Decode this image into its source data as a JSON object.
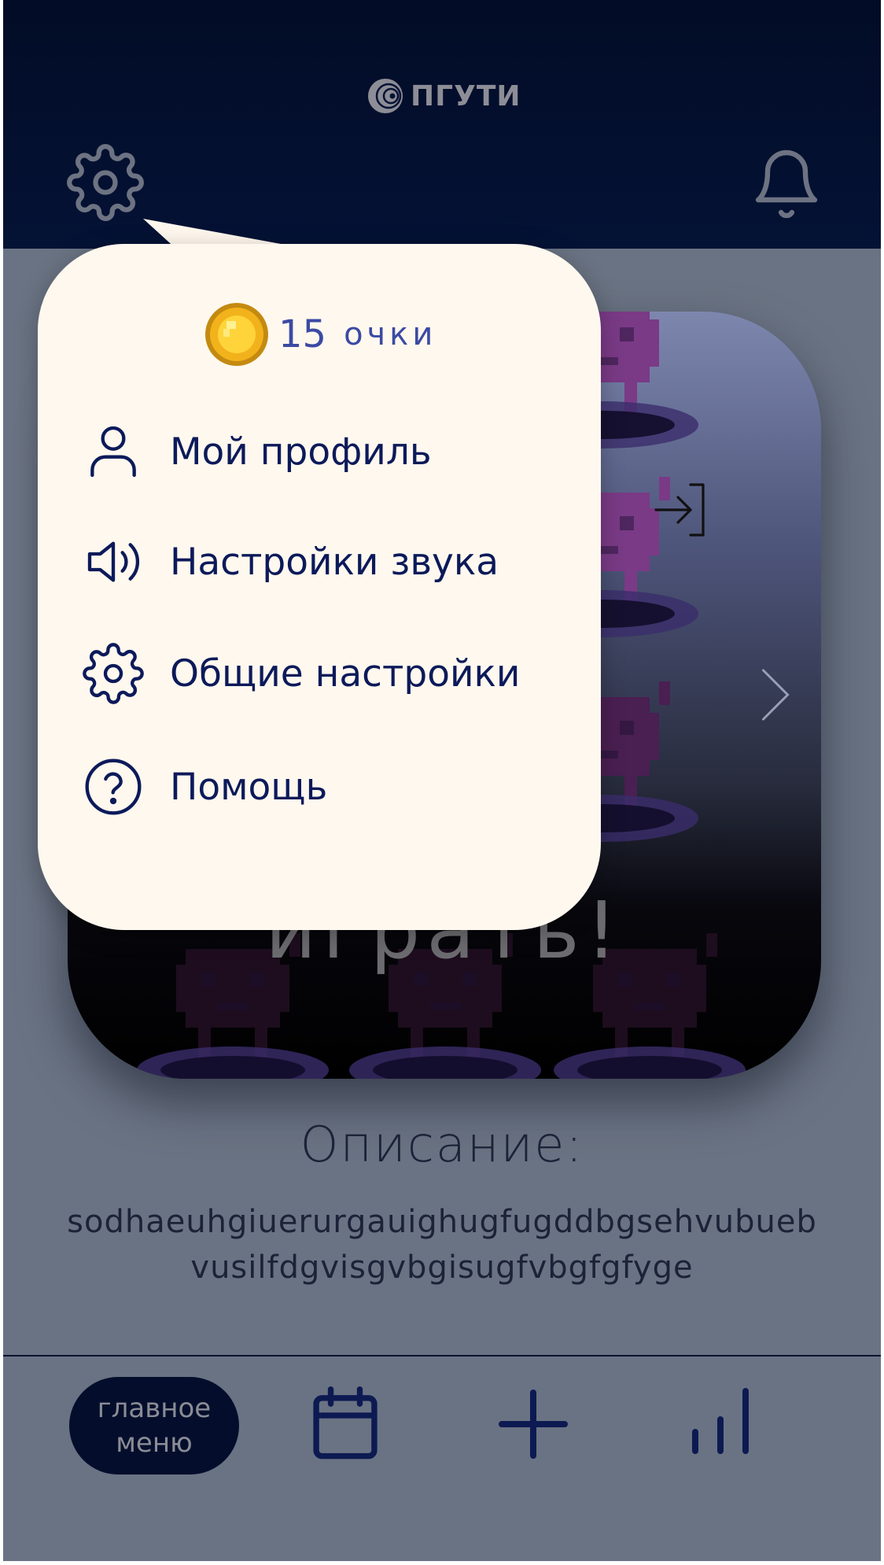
{
  "header": {
    "brand": "ПГУТИ",
    "icons": {
      "settings": "gear-icon",
      "notifications": "bell-icon"
    }
  },
  "game_card": {
    "play_label": "играть!",
    "icons": {
      "next": "chevron-right-icon",
      "enter": "log-in-icon"
    }
  },
  "description": {
    "title": "Описание:",
    "text": "sodhaeuhgiuerurgauighugfugddbgsehvubuebvusilfdgvisgvbgisugfvbgfgfyge"
  },
  "bottom_nav": {
    "home_label": "главное меню",
    "icons": [
      "calendar-icon",
      "plus-icon",
      "bar-chart-icon"
    ]
  },
  "popup_menu": {
    "points_value": "15",
    "points_unit": "очки",
    "items": [
      {
        "label": "Мой профиль",
        "icon": "user-icon"
      },
      {
        "label": "Настройки звука",
        "icon": "speaker-icon"
      },
      {
        "label": "Общие настройки",
        "icon": "gear-icon"
      },
      {
        "label": "Помощь",
        "icon": "help-circle-icon"
      }
    ]
  },
  "colors": {
    "header_bg": "#020c26",
    "popup_bg": "#fff8ee",
    "menu_text": "#0c1a5a",
    "points_text": "#3b4aa3",
    "nav_pill": "#040e2c",
    "overlay_bg": "#6a7383"
  }
}
